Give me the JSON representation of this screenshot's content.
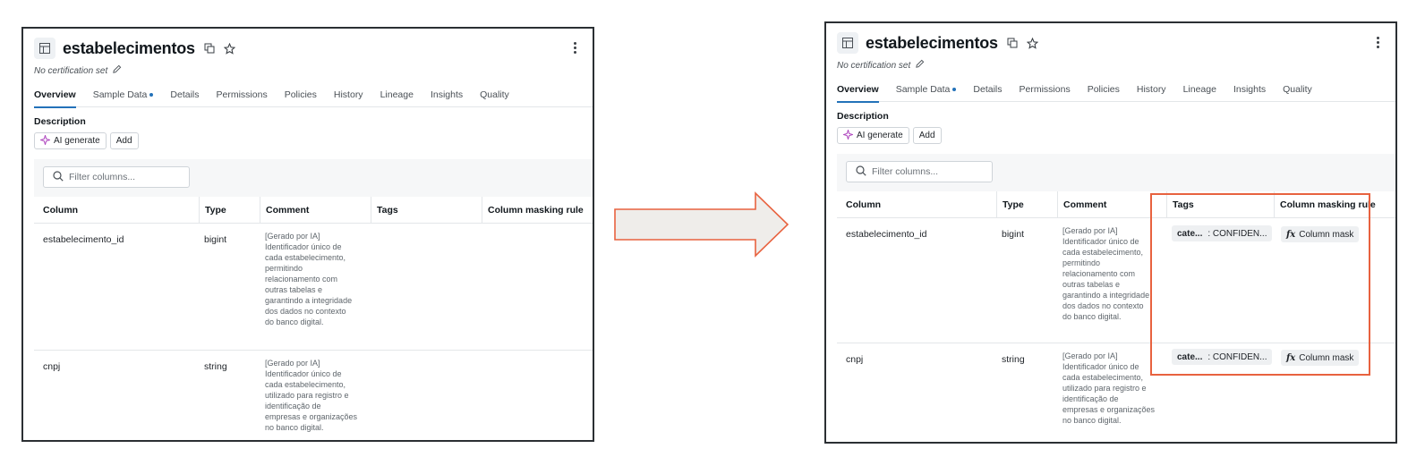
{
  "panels": {
    "before": {
      "title": "estabelecimentos",
      "certification": "No certification set",
      "tabs": [
        {
          "label": "Overview",
          "active": true
        },
        {
          "label": "Sample Data",
          "dot": true
        },
        {
          "label": "Details"
        },
        {
          "label": "Permissions"
        },
        {
          "label": "Policies"
        },
        {
          "label": "History"
        },
        {
          "label": "Lineage"
        },
        {
          "label": "Insights"
        },
        {
          "label": "Quality"
        }
      ],
      "description_label": "Description",
      "ai_generate_label": "AI generate",
      "add_label": "Add",
      "filter_placeholder": "Filter columns...",
      "columns_header": [
        "Column",
        "Type",
        "Comment",
        "Tags",
        "Column masking rule"
      ],
      "rows": [
        {
          "column": "estabelecimento_id",
          "type": "bigint",
          "comment_lines": [
            "[Gerado por IA]",
            "Identificador único de",
            "cada estabelecimento,",
            "permitindo",
            "relacionamento com",
            "outras tabelas e",
            "garantindo a integridade",
            "dos dados no contexto",
            "do banco digital."
          ]
        },
        {
          "column": "cnpj",
          "type": "string",
          "comment_lines": [
            "[Gerado por IA]",
            "Identificador único de",
            "cada estabelecimento,",
            "utilizado para registro e",
            "identificação de",
            "empresas e organizações",
            "no banco digital."
          ]
        }
      ]
    },
    "after": {
      "title": "estabelecimentos",
      "certification": "No certification set",
      "tabs": [
        {
          "label": "Overview",
          "active": true
        },
        {
          "label": "Sample Data",
          "dot": true
        },
        {
          "label": "Details"
        },
        {
          "label": "Permissions"
        },
        {
          "label": "Policies"
        },
        {
          "label": "History"
        },
        {
          "label": "Lineage"
        },
        {
          "label": "Insights"
        },
        {
          "label": "Quality"
        }
      ],
      "description_label": "Description",
      "ai_generate_label": "AI generate",
      "add_label": "Add",
      "filter_placeholder": "Filter columns...",
      "columns_header": [
        "Column",
        "Type",
        "Comment",
        "Tags",
        "Column masking rule"
      ],
      "rows": [
        {
          "column": "estabelecimento_id",
          "type": "bigint",
          "comment_lines": [
            "[Gerado por IA]",
            "Identificador único de",
            "cada estabelecimento,",
            "permitindo",
            "relacionamento com",
            "outras tabelas e",
            "garantindo a integridade",
            "dos dados no contexto",
            "do banco digital."
          ],
          "tag_key": "cate...",
          "tag_value": ": CONFIDEN...",
          "mask_label": "Column mask"
        },
        {
          "column": "cnpj",
          "type": "string",
          "comment_lines": [
            "[Gerado por IA]",
            "Identificador único de",
            "cada estabelecimento,",
            "utilizado para registro e",
            "identificação de",
            "empresas e organizações",
            "no banco digital."
          ],
          "tag_key": "cate...",
          "tag_value": ": CONFIDEN...",
          "mask_label": "Column mask"
        }
      ]
    }
  },
  "icons": {
    "table": "table-icon",
    "copy": "copy-icon",
    "star": "star-icon",
    "more": "kebab-menu-icon",
    "edit": "pencil-icon",
    "sparkle": "sparkle-icon",
    "search": "search-icon",
    "fx": "function-icon"
  },
  "colors": {
    "accent": "#2372b9",
    "highlight": "#e8623f",
    "sparkle": "#b04ac0"
  }
}
